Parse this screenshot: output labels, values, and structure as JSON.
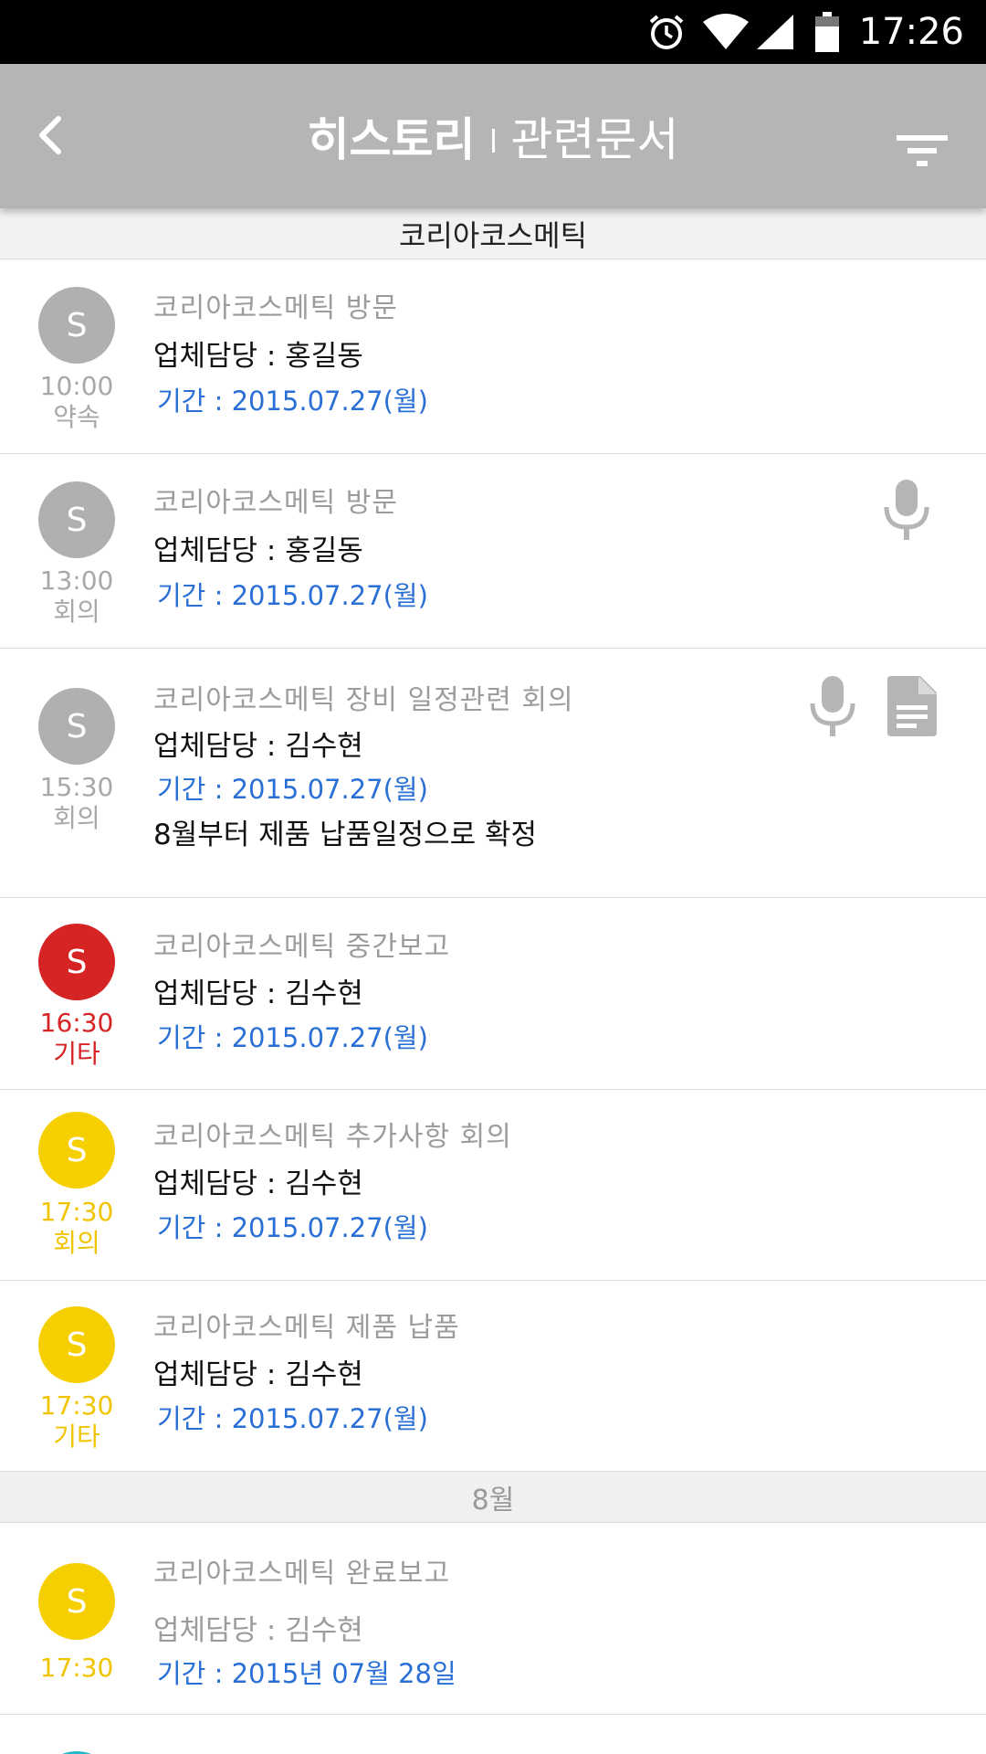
{
  "status_bar": {
    "time": "17:26",
    "icons": [
      "alarm-icon",
      "wifi-icon",
      "signal-icon",
      "battery-icon"
    ]
  },
  "app_bar": {
    "back_icon": "chevron-left-icon",
    "title": "히스토리",
    "subtitle": "관련문서",
    "filter_icon": "filter-icon",
    "background": "#b5b5b5"
  },
  "company": "코리아코스메틱",
  "colors": {
    "gray": "#b0b0b0",
    "red": "#d62424",
    "yellow": "#f5cf00",
    "link_blue": "#2a6fd6"
  },
  "items": [
    {
      "avatar": "S",
      "time": "10:00",
      "type": "약속",
      "title": "코리아코스메틱 방문",
      "manager": "업체담당 : 홍길동",
      "period": "기간 : 2015.07.27(월)"
    },
    {
      "avatar": "S",
      "time": "13:00",
      "type": "회의",
      "title": "코리아코스메틱 방문",
      "manager": "업체담당 : 홍길동",
      "period": "기간 : 2015.07.27(월)",
      "icons": [
        "microphone-icon"
      ]
    },
    {
      "avatar": "S",
      "time": "15:30",
      "type": "회의",
      "title": "코리아코스메틱 장비 일정관련 회의",
      "manager": "업체담당 : 김수현",
      "period": "기간 : 2015.07.27(월)",
      "note": "8월부터 제품 납품일정으로 확정",
      "icons": [
        "microphone-icon",
        "document-icon"
      ]
    },
    {
      "avatar": "S",
      "time": "16:30",
      "type": "기타",
      "title": "코리아코스메틱 중간보고",
      "manager": "업체담당 : 김수현",
      "period": "기간 : 2015.07.27(월)"
    },
    {
      "avatar": "S",
      "time": "17:30",
      "type": "회의",
      "title": "코리아코스메틱 추가사항 회의",
      "manager": "업체담당 : 김수현",
      "period": "기간 : 2015.07.27(월)"
    },
    {
      "avatar": "S",
      "time": "17:30",
      "type": "기타",
      "title": "코리아코스메틱 제품 납품",
      "manager": "업체담당 : 김수현",
      "period": "기간 : 2015.07.27(월)"
    }
  ],
  "month_header": "8월",
  "august_items": [
    {
      "avatar": "S",
      "time": "17:30",
      "title": "코리아코스메틱 완료보고",
      "manager": "업체담당 : 김수현",
      "period": "기간 : 2015년 07월 28일"
    }
  ]
}
